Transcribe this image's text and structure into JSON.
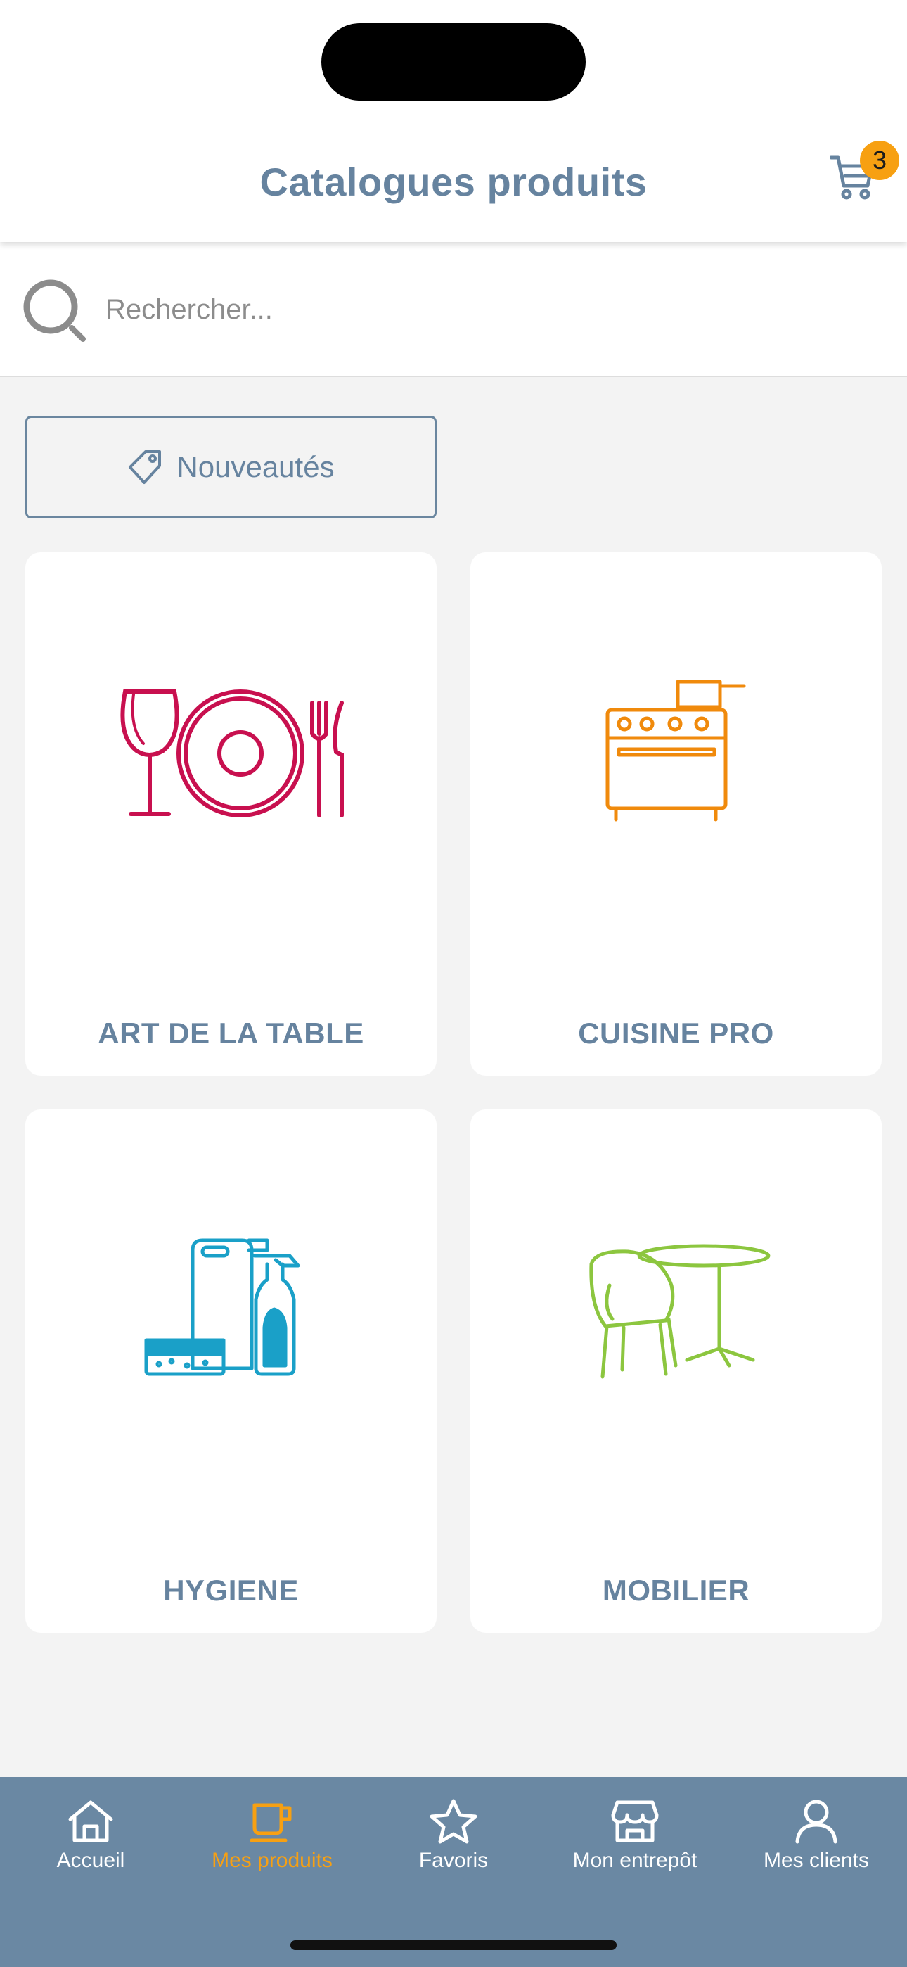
{
  "header": {
    "title": "Catalogues produits",
    "cart_count": "3"
  },
  "search": {
    "placeholder": "Rechercher..."
  },
  "new_button": {
    "label": "Nouveautés"
  },
  "categories": [
    {
      "label": "ART DE LA TABLE",
      "icon": "tableware-icon",
      "color": "#c8104f"
    },
    {
      "label": "CUISINE PRO",
      "icon": "stove-icon",
      "color": "#f08a0c"
    },
    {
      "label": "HYGIENE",
      "icon": "cleaning-products-icon",
      "color": "#1aa0c8"
    },
    {
      "label": "MOBILIER",
      "icon": "furniture-icon",
      "color": "#8cc63f"
    }
  ],
  "tabbar": {
    "items": [
      {
        "label": "Accueil",
        "icon": "home-icon"
      },
      {
        "label": "Mes produits",
        "icon": "coffee-cup-icon"
      },
      {
        "label": "Favoris",
        "icon": "star-icon"
      },
      {
        "label": "Mon entrepôt",
        "icon": "store-icon"
      },
      {
        "label": "Mes clients",
        "icon": "user-icon"
      }
    ],
    "active_index": 1
  },
  "colors": {
    "accent": "#f7a012",
    "primary": "#66839f",
    "tabbar_bg": "#6a88a3"
  }
}
